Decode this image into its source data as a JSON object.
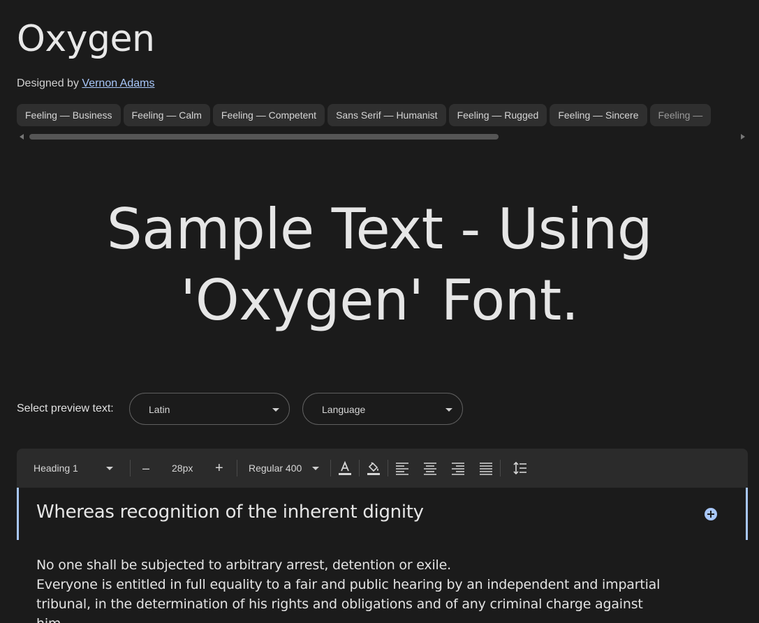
{
  "font": {
    "name": "Oxygen",
    "designed_by_prefix": "Designed by",
    "designer": "Vernon Adams"
  },
  "tags": [
    "Feeling — Business",
    "Feeling — Calm",
    "Feeling — Competent",
    "Sans Serif — Humanist",
    "Feeling — Rugged",
    "Feeling — Sincere",
    "Feeling —"
  ],
  "sample": {
    "line1": "Sample Text - Using",
    "line2": "'Oxygen' Font."
  },
  "preview": {
    "label": "Select preview text:",
    "script_value": "Latin",
    "language_value": "Language"
  },
  "toolbar": {
    "style_value": "Heading 1",
    "decrease_label": "–",
    "size_value": "28px",
    "increase_label": "+",
    "weight_value": "Regular 400",
    "icons": [
      "text-color-icon",
      "highlight-color-icon",
      "align-left-icon",
      "align-center-icon",
      "align-right-icon",
      "align-justify-icon",
      "line-height-icon"
    ]
  },
  "editor": {
    "heading": "Whereas recognition of the inherent dignity",
    "paragraphs": [
      "No one shall be subjected to arbitrary arrest, detention or exile.",
      "Everyone is entitled in full equality to a fair and public hearing by an independent and impartial tribunal, in the determination of his rights and obligations and of any criminal charge against him."
    ]
  },
  "colors": {
    "background": "#1b1b1b",
    "accent": "#a8c7fa",
    "chip_bg": "#2f2f2f",
    "toolbar_bg": "#2b2b2b"
  }
}
